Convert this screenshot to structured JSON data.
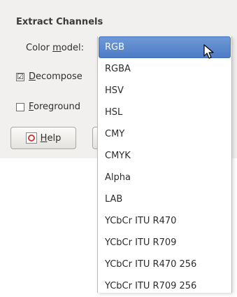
{
  "dialog": {
    "section_title": "Extract Channels",
    "color_model_label_before": "Color ",
    "color_model_label_mnemonic": "m",
    "color_model_label_after": "odel:",
    "decompose_checked_glyph": "☑",
    "decompose_mnemonic": "D",
    "decompose_rest": "ecompose",
    "foreground_mnemonic": "F",
    "foreground_rest": "oreground",
    "help_mnemonic": "H",
    "help_rest": "elp"
  },
  "menu": {
    "items": [
      "RGB",
      "RGBA",
      "HSV",
      "HSL",
      "CMY",
      "CMYK",
      "Alpha",
      "LAB",
      "YCbCr ITU R470",
      "YCbCr ITU R709",
      "YCbCr ITU R470 256",
      "YCbCr ITU R709 256"
    ],
    "selected_index": 0
  },
  "colors": {
    "selection": "#5b87cc",
    "dialog_bg": "#f1f0ef"
  },
  "icons": {
    "help": "help-icon",
    "cursor": "mouse-pointer-icon"
  }
}
